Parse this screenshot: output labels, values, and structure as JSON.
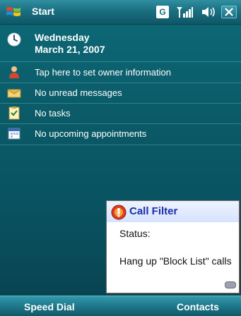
{
  "titlebar": {
    "title": "Start",
    "gprs_glyph": "G",
    "icons": [
      "windows-flag-icon",
      "gprs-icon",
      "signal-icon",
      "volume-icon",
      "close-icon"
    ]
  },
  "today": {
    "date_day": "Wednesday",
    "date_full": "March 21, 2007",
    "owner": "Tap here to set owner information",
    "messages": "No unread messages",
    "tasks": "No tasks",
    "appointments": "No upcoming appointments"
  },
  "notification": {
    "title": "Call Filter",
    "status_label": "Status:",
    "message": "Hang up \"Block List\" calls"
  },
  "softkeys": {
    "left": "Speed Dial",
    "right": "Contacts"
  },
  "colors": {
    "background": "#0b5b68",
    "bar": "#1a6f80",
    "bubble_title": "#1a2fa8"
  }
}
